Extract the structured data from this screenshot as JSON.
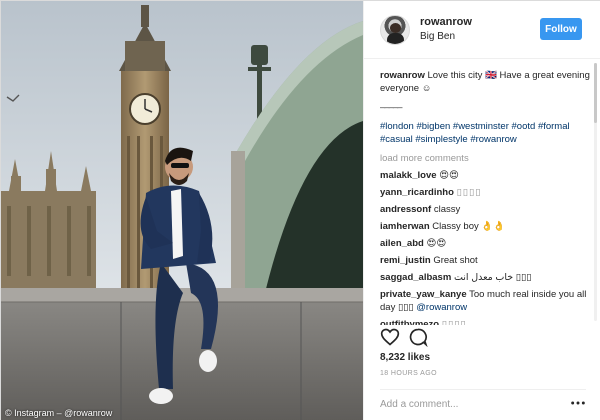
{
  "photo": {
    "credit": "© Instagram – @rowanrow"
  },
  "post": {
    "username": "rowanrow",
    "location": "Big Ben",
    "follow_label": "Follow"
  },
  "caption": {
    "username": "rowanrow",
    "text": "Love this city 🇬🇧 Have a great evening everyone ☺",
    "divider": "_____",
    "hashtags": [
      "#london",
      "#bigben",
      "#westminster",
      "#ootd",
      "#formal",
      "#casual",
      "#simplestyle",
      "#rowanrow"
    ]
  },
  "load_more": "load more comments",
  "comments": [
    {
      "user": "malakk_love",
      "text": "😍😍"
    },
    {
      "user": "yann_ricardinho",
      "text": "▯▯▯▯"
    },
    {
      "user": "andressonf",
      "text": "classy"
    },
    {
      "user": "iamherwan",
      "text": "Classy boy 👌👌"
    },
    {
      "user": "ailen_abd",
      "text": "😍😍"
    },
    {
      "user": "remi_justin",
      "text": "Great shot"
    },
    {
      "user": "saggad_albasm",
      "text": "خاب معدل انت ▯▯▯"
    },
    {
      "user": "private_yaw_kanye",
      "text": "Too much real inside you all day ▯▯▯",
      "mention": "@rowanrow"
    },
    {
      "user": "outfitbymezo",
      "text": "▯▯▯▯"
    }
  ],
  "stats": {
    "likes": "8,232 likes",
    "timestamp": "18 HOURS AGO"
  },
  "add_comment": {
    "placeholder": "Add a comment..."
  },
  "colors": {
    "accent": "#3897f0",
    "hashtag": "#003569",
    "muted": "#999999"
  },
  "icons": [
    "heart-icon",
    "comment-icon",
    "more-options-icon"
  ]
}
